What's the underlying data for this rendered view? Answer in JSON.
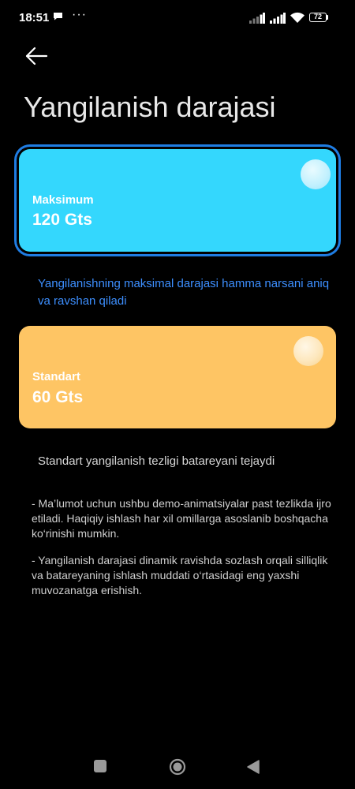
{
  "status_bar": {
    "time": "18:51",
    "more": "···",
    "battery_level": "72",
    "icons": [
      "message-icon",
      "more-icon",
      "signal-icon",
      "signal-icon",
      "wifi-icon",
      "battery-icon"
    ]
  },
  "header": {
    "back_icon": "arrow-left-icon",
    "title": "Yangilanish darajasi"
  },
  "options": [
    {
      "label": "Maksimum",
      "value": "120 Gts",
      "selected": true,
      "color": "#34d7fd",
      "description": "Yangilanishning maksimal darajasi hamma narsani aniq va ravshan qiladi"
    },
    {
      "label": "Standart",
      "value": "60 Gts",
      "selected": false,
      "color": "#fec564",
      "description": "Standart yangilanish tezligi batareyani tejaydi"
    }
  ],
  "notes": [
    "- Ma’lumot uchun ushbu demo-animatsiyalar past tezlikda ijro etiladi. Haqiqiy ishlash har xil omillarga asoslanib boshqacha ko‘rinishi mumkin.",
    "- Yangilanish darajasi dinamik ravishda sozlash orqali silliqlik va batareyaning ishlash muddati o‘rtasidagi eng yaxshi muvozanatga erishish."
  ],
  "colors": {
    "background": "#000000",
    "selected_border": "#1f7de3",
    "description_selected": "#3d8fff",
    "text_secondary": "#cfcfcf"
  },
  "nav_bar": {
    "icons": [
      "recents-icon",
      "home-icon",
      "back-triangle-icon"
    ]
  }
}
